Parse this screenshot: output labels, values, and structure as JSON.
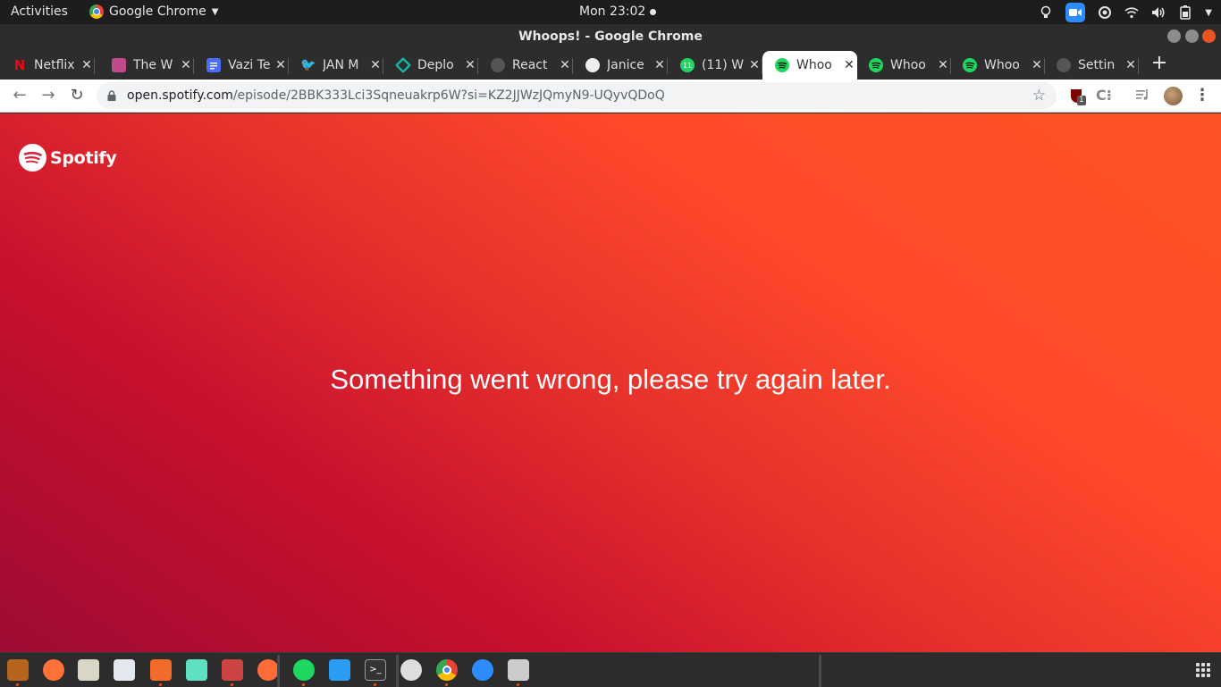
{
  "topbar": {
    "activities": "Activities",
    "app_name": "Google Chrome",
    "clock": "Mon 23:02"
  },
  "window": {
    "title": "Whoops! - Google Chrome"
  },
  "tabs": [
    {
      "label": "Netflix",
      "favicon": "netflix-icon",
      "color": "#e50914",
      "active": false
    },
    {
      "label": "The W",
      "favicon": "generic-site-icon",
      "color": "#c04a8a",
      "active": false
    },
    {
      "label": "Vazi Te",
      "favicon": "docs-icon",
      "color": "#4c6ef5",
      "active": false
    },
    {
      "label": "JAN M",
      "favicon": "twitter-icon",
      "color": "#1da1f2",
      "active": false
    },
    {
      "label": "Deplo",
      "favicon": "deploy-icon",
      "color": "#10b9a5",
      "active": false
    },
    {
      "label": "React",
      "favicon": "globe-icon",
      "color": "#555555",
      "active": false
    },
    {
      "label": "Janice",
      "favicon": "github-icon",
      "color": "#eeeeee",
      "active": false
    },
    {
      "label": "(11) W",
      "favicon": "whatsapp-icon",
      "color": "#25d366",
      "active": false
    },
    {
      "label": "Whoo",
      "favicon": "spotify-icon",
      "color": "#1ed760",
      "active": true
    },
    {
      "label": "Whoo",
      "favicon": "spotify-icon",
      "color": "#1ed760",
      "active": false
    },
    {
      "label": "Whoo",
      "favicon": "spotify-icon",
      "color": "#1ed760",
      "active": false
    },
    {
      "label": "Settin",
      "favicon": "settings-icon",
      "color": "#555555",
      "active": false
    }
  ],
  "omnibox": {
    "host": "open.spotify.com",
    "path": "/episode/2BBK333Lci3Sqneuakrp6W?si=KZ2JJWzJQmyN9-UQyvQDoQ"
  },
  "extensions": {
    "ublock_badge": "1"
  },
  "page": {
    "brand": "Spotify",
    "error_message": "Something went wrong, please try again later."
  },
  "colors": {
    "spotify_green": "#1ed760",
    "gradient_start": "#9e0b33",
    "gradient_end": "#ff5224",
    "ubuntu_orange": "#e95420"
  },
  "dock": [
    {
      "name": "files-icon",
      "color": "#b5651d"
    },
    {
      "name": "firefox-icon",
      "color": "#ff7139"
    },
    {
      "name": "archive-icon",
      "color": "#d9d6c7"
    },
    {
      "name": "document-icon",
      "color": "#e3e8ef"
    },
    {
      "name": "software-icon",
      "color": "#f26b2a"
    },
    {
      "name": "app-icon",
      "color": "#5fe0c2"
    },
    {
      "name": "media-icon",
      "color": "#c44"
    },
    {
      "name": "postman-icon",
      "color": "#ff6c37"
    },
    {
      "name": "spotify-icon",
      "color": "#1ed760"
    },
    {
      "name": "vscode-icon",
      "color": "#2a9cf2"
    },
    {
      "name": "terminal-icon",
      "color": "#333333"
    },
    {
      "name": "inkscape-icon",
      "color": "#dddddd"
    },
    {
      "name": "chrome-icon",
      "color": "#4285f4"
    },
    {
      "name": "zoom-icon",
      "color": "#2d8cff"
    },
    {
      "name": "scanner-icon",
      "color": "#cccccc"
    }
  ]
}
